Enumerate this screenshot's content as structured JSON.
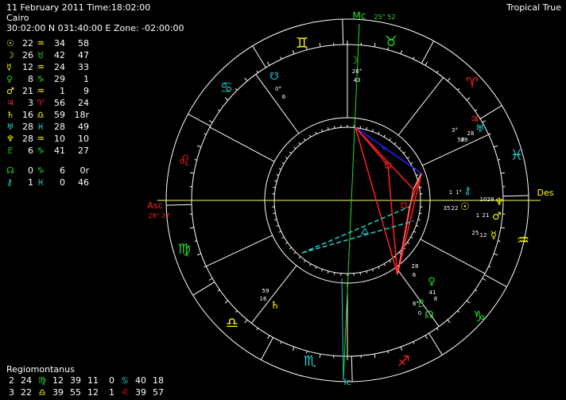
{
  "header": {
    "date_time": "11 February 2011 Time:18:02:00",
    "location": "Cairo",
    "coords": "30:02:00 N 031:40:00 E Zone: -02:00:00",
    "mode": "Tropical True"
  },
  "colors": {
    "background": "#000000",
    "fire": "#ff2020",
    "earth": "#22dd22",
    "air": "#ffff00",
    "water": "#22cccc",
    "text": "#ffffff"
  },
  "planets": [
    {
      "glyph": "☉",
      "name": "sun-icon",
      "deg": "22",
      "sign": "♒",
      "min": "34",
      "sec": "58",
      "color": "#ffff00",
      "signcolor": "#ffff00"
    },
    {
      "glyph": "☽",
      "name": "moon-icon",
      "deg": "26",
      "sign": "♉",
      "min": "42",
      "sec": "47",
      "color": "#ffff00",
      "signcolor": "#22dd22"
    },
    {
      "glyph": "☿",
      "name": "mercury-icon",
      "deg": "12",
      "sign": "♒",
      "min": "24",
      "sec": "33",
      "color": "#ffff00",
      "signcolor": "#ffff00"
    },
    {
      "glyph": "♀",
      "name": "venus-icon",
      "deg": "8",
      "sign": "♑",
      "min": "29",
      "sec": "1",
      "color": "#22dd22",
      "signcolor": "#22dd22"
    },
    {
      "glyph": "♂",
      "name": "mars-icon",
      "deg": "21",
      "sign": "♒",
      "min": "1",
      "sec": "9",
      "color": "#ffff00",
      "signcolor": "#ffff00"
    },
    {
      "glyph": "♃",
      "name": "jupiter-icon",
      "deg": "3",
      "sign": "♈",
      "min": "56",
      "sec": "24",
      "color": "#ff2020",
      "signcolor": "#ff2020"
    },
    {
      "glyph": "♄",
      "name": "saturn-icon",
      "deg": "16",
      "sign": "♎",
      "min": "59",
      "sec": "18r",
      "color": "#ffff00",
      "signcolor": "#ffff00"
    },
    {
      "glyph": "♅",
      "name": "uranus-icon",
      "deg": "28",
      "sign": "♓",
      "min": "28",
      "sec": "49",
      "color": "#22cccc",
      "signcolor": "#22cccc"
    },
    {
      "glyph": "♆",
      "name": "neptune-icon",
      "deg": "28",
      "sign": "♒",
      "min": "10",
      "sec": "10",
      "color": "#ffff00",
      "signcolor": "#ffff00"
    },
    {
      "glyph": "♇",
      "name": "pluto-icon",
      "deg": "6",
      "sign": "♑",
      "min": "41",
      "sec": "27",
      "color": "#22dd22",
      "signcolor": "#22dd22"
    },
    {
      "glyph": "☊",
      "name": "north-node-icon",
      "deg": "0",
      "sign": "♑",
      "min": "6",
      "sec": "0r",
      "color": "#22dd22",
      "signcolor": "#22dd22"
    },
    {
      "glyph": "⚷",
      "name": "chiron-icon",
      "deg": "1",
      "sign": "♓",
      "min": "0",
      "sec": "46",
      "color": "#22cccc",
      "signcolor": "#22cccc"
    }
  ],
  "house_system": "Regiomontanus",
  "houses": [
    [
      {
        "n": "2",
        "deg": "24",
        "sign": "♍",
        "min": "12",
        "sc": "#22dd22"
      },
      {
        "n": "",
        "deg": "39",
        "sign": "",
        "min": "11",
        "sc": ""
      },
      {
        "n": "0",
        "deg": "",
        "sign": "♋",
        "min": "40 18",
        "sc": "#22cccc"
      }
    ],
    [
      {
        "n": "3",
        "deg": "22",
        "sign": "♎",
        "min": "39",
        "sc": "#ffff00"
      },
      {
        "n": "",
        "deg": "55",
        "sign": "",
        "min": "12",
        "sc": ""
      },
      {
        "n": "1",
        "deg": "",
        "sign": "♌",
        "min": "39 57",
        "sc": "#ff2020"
      }
    ]
  ],
  "house_rows_text": [
    {
      "a": "2",
      "b": "24",
      "s1": "♍",
      "c": "12",
      "d": "39",
      "e": "11",
      "f": "0",
      "s2": "♋",
      "g": "40",
      "h": "18",
      "c1": "#22dd22",
      "c2": "#22cccc"
    },
    {
      "a": "3",
      "b": "22",
      "s1": "♎",
      "c": "39",
      "d": "55",
      "e": "12",
      "f": "1",
      "s2": "♌",
      "g": "39",
      "h": "57",
      "c1": "#ffff00",
      "c2": "#ff2020"
    }
  ],
  "chart_labels": {
    "mc": "Mc",
    "mc_deg": "25° 52",
    "asc": "Asc",
    "asc_deg": "28° 27",
    "des": "Des",
    "ic": "Ic"
  },
  "zodiac_ring": [
    {
      "glyph": "♊",
      "name": "gemini-icon",
      "color": "#ffff00"
    },
    {
      "glyph": "♉",
      "name": "taurus-icon",
      "color": "#22dd22"
    },
    {
      "glyph": "♈",
      "name": "aries-icon",
      "color": "#ff2020"
    },
    {
      "glyph": "♓",
      "name": "pisces-icon",
      "color": "#22cccc"
    },
    {
      "glyph": "♒",
      "name": "aquarius-icon",
      "color": "#ffff00"
    },
    {
      "glyph": "♑",
      "name": "capricorn-icon",
      "color": "#22dd22"
    },
    {
      "glyph": "♐",
      "name": "sagittarius-icon",
      "color": "#ff2020"
    },
    {
      "glyph": "♏",
      "name": "scorpio-icon",
      "color": "#22cccc"
    },
    {
      "glyph": "♎",
      "name": "libra-icon",
      "color": "#ffff00"
    },
    {
      "glyph": "♍",
      "name": "virgo-icon",
      "color": "#22dd22"
    },
    {
      "glyph": "♌",
      "name": "leo-icon",
      "color": "#ff2020"
    },
    {
      "glyph": "♋",
      "name": "cancer-icon",
      "color": "#22cccc"
    }
  ],
  "house_numbers": [
    "1",
    "2",
    "3",
    "4",
    "5",
    "6",
    "7",
    "8",
    "9",
    "10",
    "11",
    "12"
  ],
  "wheel_planets": [
    {
      "name": "wheel-moon",
      "glyph": "☽",
      "color": "#22dd22",
      "deg": "26°",
      "min": "43"
    },
    {
      "name": "wheel-node-top",
      "glyph": "☋",
      "color": "#22cccc",
      "deg": "0°",
      "min": "6"
    },
    {
      "name": "wheel-jupiter",
      "glyph": "♃",
      "color": "#ff2020",
      "deg": "3°",
      "min": "56"
    },
    {
      "name": "wheel-uranus",
      "glyph": "♅",
      "color": "#22cccc",
      "deg": "28",
      "min": "29"
    },
    {
      "name": "wheel-chiron",
      "glyph": "⚷",
      "color": "#22cccc",
      "deg": "1",
      "min": "1°"
    },
    {
      "name": "wheel-neptune",
      "glyph": "♆",
      "color": "#ffff00",
      "deg": "10",
      "min": "28"
    },
    {
      "name": "wheel-sun",
      "glyph": "☉",
      "color": "#ffff00",
      "deg": "35",
      "min": "22"
    },
    {
      "name": "wheel-mars",
      "glyph": "♂",
      "color": "#ffff00",
      "deg": "1",
      "min": "21"
    },
    {
      "name": "wheel-mercury",
      "glyph": "☿",
      "color": "#ffff00",
      "deg": "25",
      "min": "12"
    },
    {
      "name": "wheel-venus",
      "glyph": "♀",
      "color": "#22dd22",
      "deg": "41",
      "min": "8"
    },
    {
      "name": "wheel-pluto",
      "glyph": "♇",
      "color": "#22dd22",
      "deg": "6°",
      "min": "0"
    },
    {
      "name": "wheel-node",
      "glyph": "☊",
      "color": "#22dd22",
      "deg": "28",
      "min": "6"
    },
    {
      "name": "wheel-saturn",
      "glyph": "♄",
      "color": "#ffff00",
      "deg": "59",
      "min": "16"
    }
  ]
}
